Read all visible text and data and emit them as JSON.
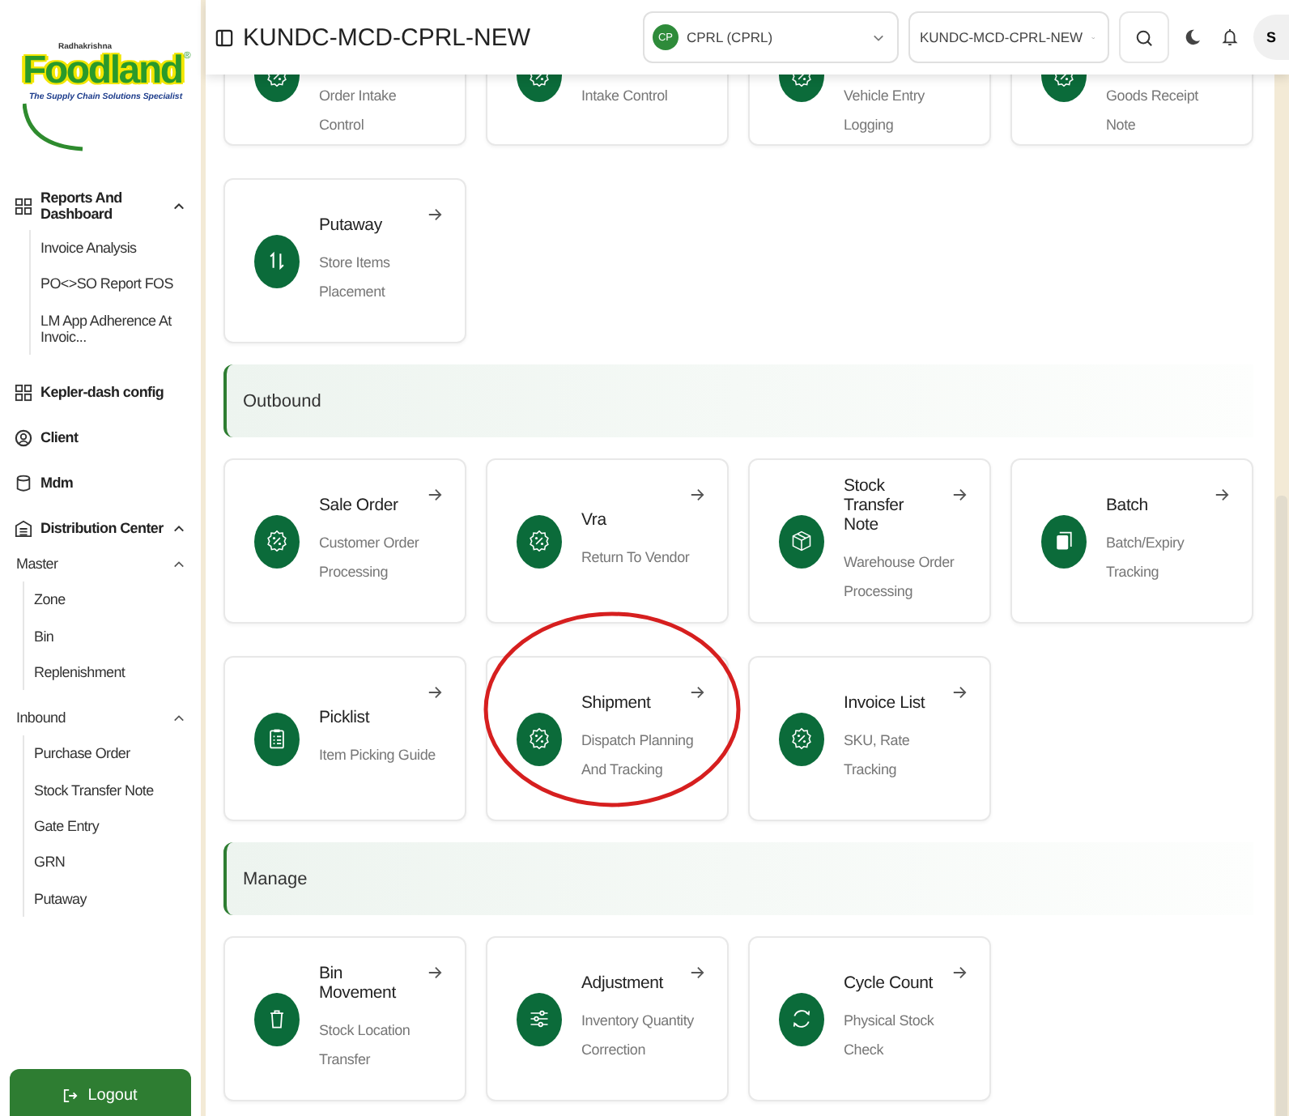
{
  "logo": {
    "overline": "Radhakrishna",
    "name": "Foodland",
    "mark": "®",
    "tagline": "The Supply Chain Solutions Specialist"
  },
  "sidebar": {
    "items": [
      {
        "label": "Reports And Dashboard",
        "expanded": true,
        "children": [
          {
            "label": "Invoice Analysis"
          },
          {
            "label": "PO<>SO Report FOS"
          },
          {
            "label": "LM App Adherence At Invoic..."
          }
        ]
      },
      {
        "label": "Kepler-dash config"
      },
      {
        "label": "Client"
      },
      {
        "label": "Mdm"
      },
      {
        "label": "Distribution Center",
        "expanded": true,
        "children": [
          {
            "label": "Master",
            "expanded": true,
            "children": [
              {
                "label": "Zone"
              },
              {
                "label": "Bin"
              },
              {
                "label": "Replenishment"
              }
            ]
          },
          {
            "label": "Inbound",
            "expanded": true,
            "children": [
              {
                "label": "Purchase Order"
              },
              {
                "label": "Stock Transfer Note"
              },
              {
                "label": "Gate Entry"
              },
              {
                "label": "GRN"
              },
              {
                "label": "Putaway"
              }
            ]
          }
        ]
      }
    ],
    "logout": "Logout"
  },
  "header": {
    "title": "KUNDC-MCD-CPRL-NEW",
    "client_select": {
      "badge": "CP",
      "value": "CPRL (CPRL)"
    },
    "dc_select": {
      "value": "KUNDC-MCD-CPRL-NEW"
    },
    "avatar": "S"
  },
  "sections": [
    {
      "cards": [
        {
          "kind": "clipped",
          "subtitle": "Order Intake Control",
          "highlighted": false
        },
        {
          "kind": "clipped",
          "subtitle": "Intake Control",
          "highlighted": false
        },
        {
          "kind": "clipped",
          "subtitle": "Vehicle Entry Logging",
          "highlighted": false
        },
        {
          "kind": "clipped",
          "subtitle": "Goods Receipt Note",
          "highlighted": false
        },
        {
          "kind": "card",
          "title": "Putaway",
          "subtitle": "Store Items Placement",
          "highlighted": false
        }
      ]
    },
    {
      "title": "Outbound",
      "cards": [
        {
          "kind": "card",
          "title": "Sale Order",
          "subtitle": "Customer Order Processing",
          "highlighted": false
        },
        {
          "kind": "card",
          "title": "Vra",
          "subtitle": "Return To Vendor",
          "highlighted": false
        },
        {
          "kind": "card",
          "title": "Stock Transfer Note",
          "subtitle": "Warehouse Order Processing",
          "highlighted": false
        },
        {
          "kind": "card",
          "title": "Batch",
          "subtitle": "Batch/Expiry Tracking",
          "highlighted": false
        },
        {
          "kind": "card",
          "title": "Picklist",
          "subtitle": "Item Picking Guide",
          "highlighted": false
        },
        {
          "kind": "card",
          "title": "Shipment",
          "subtitle": "Dispatch Planning And Tracking",
          "highlighted": true
        },
        {
          "kind": "card",
          "title": "Invoice List",
          "subtitle": "SKU, Rate Tracking",
          "highlighted": false
        }
      ]
    },
    {
      "title": "Manage",
      "cards": [
        {
          "kind": "card",
          "title": "Bin Movement",
          "subtitle": "Stock Location Transfer",
          "highlighted": false
        },
        {
          "kind": "card",
          "title": "Adjustment",
          "subtitle": "Inventory Quantity Correction",
          "highlighted": false
        },
        {
          "kind": "card",
          "title": "Cycle Count",
          "subtitle": "Physical Stock Check",
          "highlighted": false
        }
      ]
    }
  ]
}
